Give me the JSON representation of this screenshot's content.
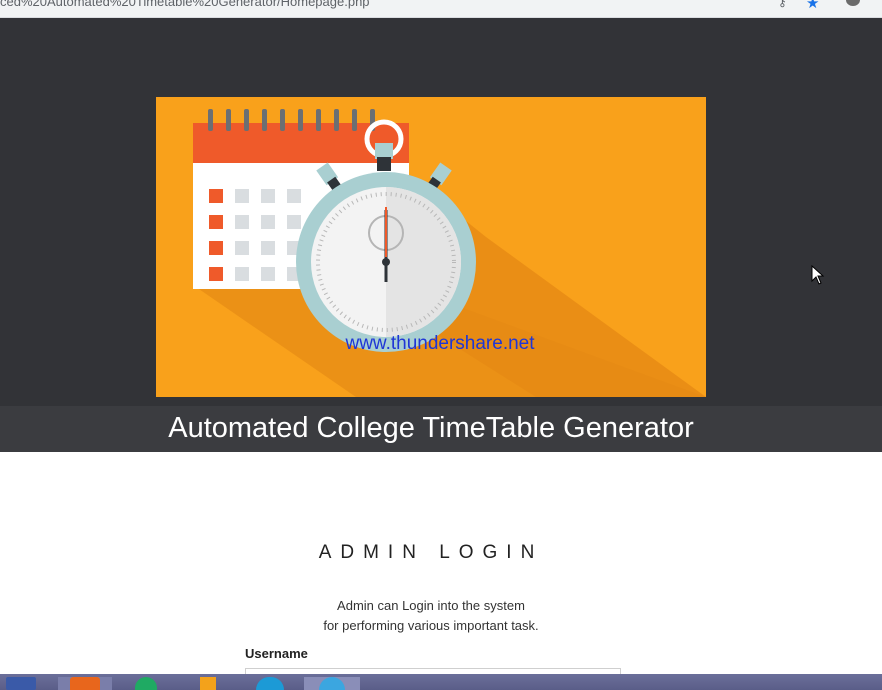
{
  "browser": {
    "url": "ced%20Automated%20Timetable%20Generator/Homepage.php"
  },
  "hero": {
    "watermark": "www.thundershare.net",
    "caption": "Automated College TimeTable Generator"
  },
  "login": {
    "title": "ADMIN LOGIN",
    "description_line1": "Admin can Login into the system",
    "description_line2": "for performing various important task.",
    "username_label": "Username",
    "username_value": ""
  },
  "colors": {
    "hero_bg": "#323337",
    "banner_bg": "#f9a11b",
    "calendar_header": "#ef5a2a",
    "watermark": "#1f36d6"
  },
  "taskbar": {
    "items": [
      "start-button-icon",
      "app-icon-1",
      "app-icon-2",
      "app-icon-3",
      "edge-icon",
      "browser-icon"
    ]
  }
}
